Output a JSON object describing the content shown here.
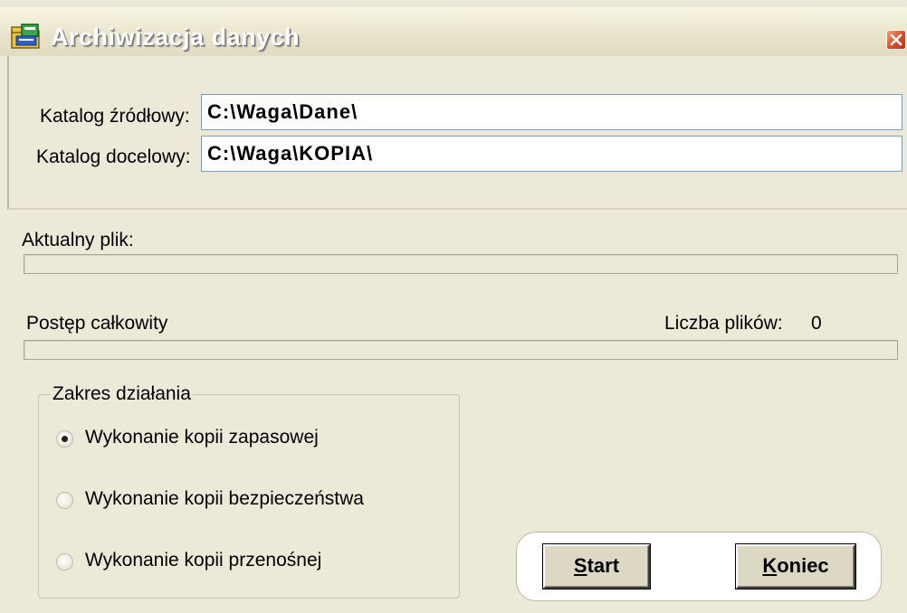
{
  "window": {
    "title": "Archiwizacja danych",
    "app_icon": "folder-archive-icon",
    "close_icon": "close-icon"
  },
  "fields": {
    "source_label": "Katalog źródłowy:",
    "source_value": "C:\\Waga\\Dane\\",
    "target_label": "Katalog docelowy:",
    "target_value": "C:\\Waga\\KOPIA\\"
  },
  "progress": {
    "current_file_label": "Aktualny plik:",
    "current_file_progress": 0,
    "total_label": "Postęp całkowity",
    "total_progress": 0,
    "file_count_label": "Liczba plików:",
    "file_count": "0"
  },
  "scope": {
    "legend": "Zakres działania",
    "options": [
      {
        "label": "Wykonanie kopii zapasowej",
        "checked": true
      },
      {
        "label": "Wykonanie kopii bezpieczeństwa",
        "checked": false
      },
      {
        "label": "Wykonanie kopii przenośnej",
        "checked": false
      }
    ]
  },
  "buttons": {
    "start_mnemonic": "S",
    "start_rest": "tart",
    "end_mnemonic": "K",
    "end_rest": "oniec"
  },
  "colors": {
    "dialog_bg": "#ece9d8",
    "close_button": "#d84a25",
    "input_border": "#7f9db9"
  }
}
